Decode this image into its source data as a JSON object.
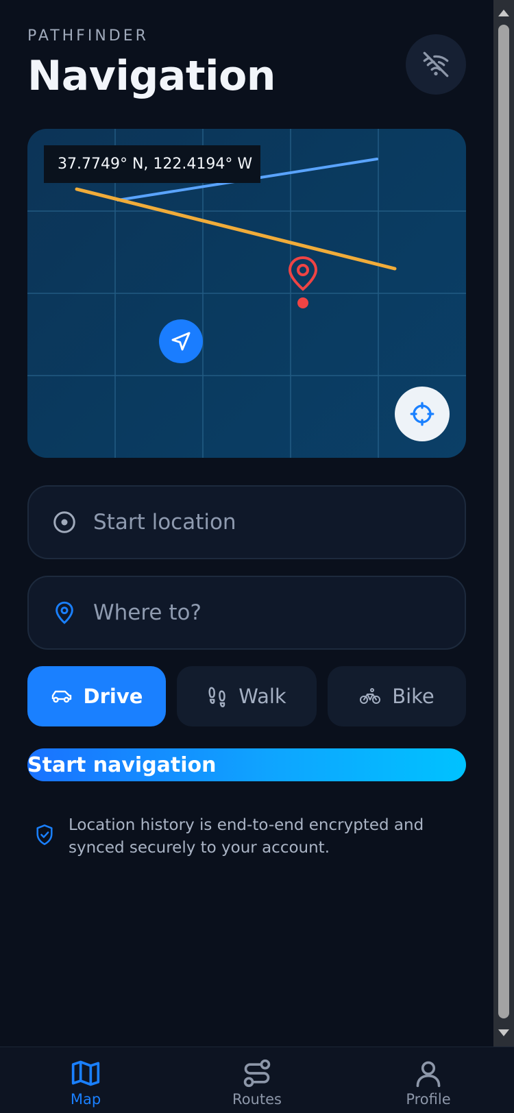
{
  "header": {
    "eyebrow": "PATHFINDER",
    "title": "Navigation"
  },
  "map": {
    "coordinates": "37.7749° N, 122.4194° W"
  },
  "fields": {
    "start_placeholder": "Start location",
    "destination_placeholder": "Where to?"
  },
  "modes": [
    {
      "label": "Drive",
      "icon": "car-icon",
      "selected": true
    },
    {
      "label": "Walk",
      "icon": "footprints-icon",
      "selected": false
    },
    {
      "label": "Bike",
      "icon": "bike-icon",
      "selected": false
    }
  ],
  "actions": {
    "start_navigation": "Start navigation"
  },
  "notice": {
    "text": "Location history is end-to-end encrypted and synced securely to your account."
  },
  "tabs": [
    {
      "label": "Map",
      "icon": "map-icon",
      "active": true
    },
    {
      "label": "Routes",
      "icon": "routes-icon",
      "active": false
    },
    {
      "label": "Profile",
      "icon": "profile-icon",
      "active": false
    }
  ],
  "colors": {
    "accent": "#1a80ff",
    "background": "#0a101c",
    "route_primary": "#5aa4ff",
    "route_alt": "#f0ac3a",
    "pin": "#ef4444"
  }
}
